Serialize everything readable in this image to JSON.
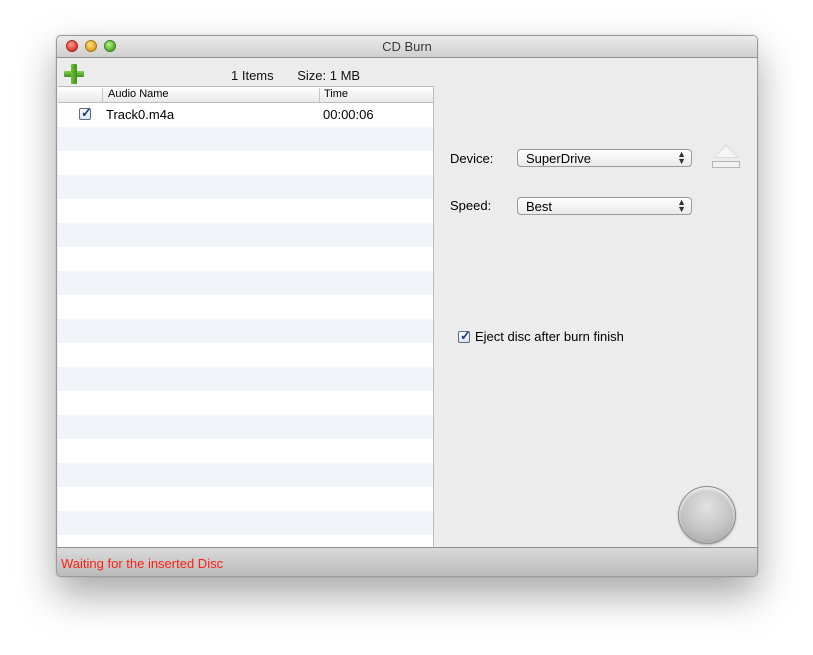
{
  "window": {
    "title": "CD Burn"
  },
  "toolbar": {
    "add_icon": "plus-icon",
    "items_text": "1 Items",
    "size_text": "Size: 1 MB"
  },
  "table": {
    "columns": [
      "Audio Name",
      "Time"
    ],
    "rows": [
      {
        "checked": true,
        "name": "Track0.m4a",
        "time": "00:00:06"
      }
    ]
  },
  "device": {
    "label": "Device:",
    "value": "SuperDrive",
    "icon": "eject-icon"
  },
  "speed": {
    "label": "Speed:",
    "value": "Best"
  },
  "eject_option": {
    "label": "Eject disc after burn finish",
    "checked": true
  },
  "burn_button": {
    "icon": "burn-button"
  },
  "status": {
    "text": "Waiting for the inserted Disc",
    "color": "#ff1d12"
  }
}
